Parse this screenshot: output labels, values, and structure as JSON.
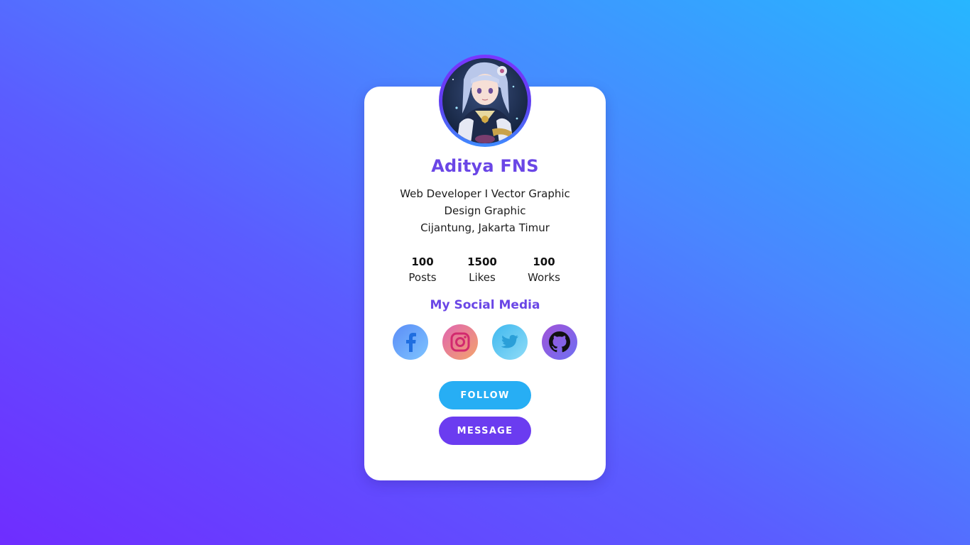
{
  "profile": {
    "name": "Aditya FNS",
    "bio": [
      "Web Developer I Vector Graphic",
      "Design Graphic",
      "Cijantung, Jakarta Timur"
    ]
  },
  "stats": [
    {
      "value": "100",
      "label": "Posts"
    },
    {
      "value": "1500",
      "label": "Likes"
    },
    {
      "value": "100",
      "label": "Works"
    }
  ],
  "social": {
    "title": "My Social Media",
    "links": [
      {
        "icon": "facebook-icon"
      },
      {
        "icon": "instagram-icon"
      },
      {
        "icon": "twitter-icon"
      },
      {
        "icon": "github-icon"
      }
    ]
  },
  "actions": {
    "follow_label": "FOLLOW",
    "message_label": "MESSAGE"
  },
  "colors": {
    "accent_purple": "#6a46e6",
    "follow_blue": "#27aef4",
    "message_purple": "#6b3cf0"
  }
}
